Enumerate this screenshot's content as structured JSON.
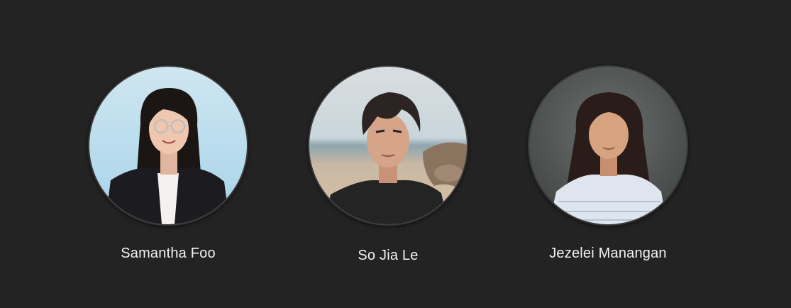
{
  "team": {
    "members": [
      {
        "name": "Samantha Foo",
        "avatar_icon": "portrait-photo"
      },
      {
        "name": "So Jia Le",
        "avatar_icon": "portrait-photo"
      },
      {
        "name": "Jezelei Manangan",
        "avatar_icon": "portrait-photo"
      }
    ]
  }
}
